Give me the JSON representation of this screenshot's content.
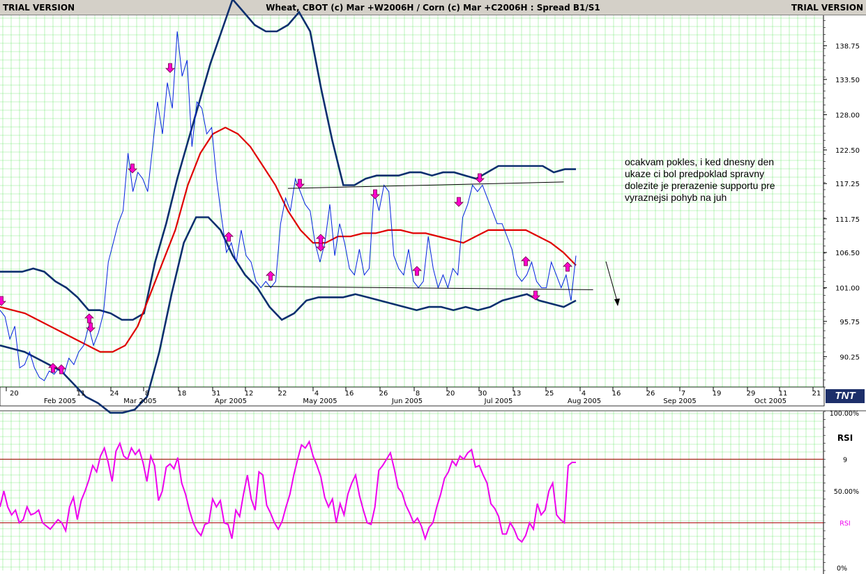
{
  "window": {
    "trial_left": "TRIAL VERSION",
    "trial_right": "TRIAL VERSION",
    "title": "Wheat, CBOT (c) Mar +W2006H / Corn (c) Mar +C2006H : Spread B1/S1"
  },
  "annotation": {
    "lines": [
      "ocakvam pokles, i ked dnesny den",
      "ukaze ci bol predpoklad spravny",
      "dolezite je prerazenie supportu pre",
      "vyraznejsi pohyb na juh"
    ]
  },
  "logo": {
    "text": "TNT"
  },
  "colors": {
    "background": "#ffffff",
    "grid": "#33dd33",
    "price_line": "#0022dd",
    "bands": "#0b2f6e",
    "moving_average": "#e00000",
    "rsi_line": "#ee00ee",
    "arrows": "#ff00cc",
    "rsi_levels": "#aa0000"
  },
  "chart_data": [
    {
      "type": "line",
      "title": "Wheat, CBOT (c) Mar +W2006H / Corn (c) Mar +C2006H : Spread B1/S1",
      "x_axis": {
        "tick_labels": [
          "20",
          "11",
          "24",
          "8",
          "18",
          "31",
          "12",
          "22",
          "4",
          "16",
          "26",
          "8",
          "20",
          "30",
          "13",
          "25",
          "4",
          "16",
          "26",
          "7",
          "19",
          "29",
          "11",
          "21"
        ],
        "month_labels": [
          "Feb 2005",
          "Mar 2005",
          "Apr 2005",
          "May 2005",
          "Jun 2005",
          "Jul 2005",
          "Aug 2005",
          "Sep 2005",
          "Oct 2005"
        ]
      },
      "y_axis": {
        "tick_labels": [
          "138.75",
          "133.50",
          "128.00",
          "122.50",
          "117.25",
          "111.75",
          "106.50",
          "101.00",
          "95.75",
          "90.25"
        ],
        "ylim": [
          85.5,
          143.5
        ],
        "position": "right"
      },
      "grid": true,
      "series": [
        {
          "key": "price",
          "values": [
            97.5,
            96.5,
            93,
            95,
            88.5,
            89,
            91,
            88.5,
            87,
            86.5,
            88,
            87.5,
            88.5,
            87.5,
            90,
            89,
            91,
            92,
            95,
            92,
            94,
            97,
            105,
            108,
            111,
            113,
            122,
            116,
            119,
            118,
            116,
            123,
            130,
            125,
            133,
            129,
            141,
            134,
            136.5,
            123,
            130,
            129,
            125,
            126,
            118,
            112,
            106.5,
            108,
            105,
            110,
            106,
            105,
            102,
            101,
            102,
            101,
            102,
            111,
            115,
            113,
            118,
            116,
            114,
            113,
            108,
            105,
            108,
            114,
            106,
            111,
            108,
            104,
            103,
            107,
            103,
            104,
            116,
            113,
            117,
            116,
            106,
            104,
            103,
            107,
            102,
            101,
            102,
            109,
            104,
            101,
            103,
            101,
            104,
            103,
            112,
            114,
            117,
            116,
            117,
            115,
            113,
            111,
            111,
            109,
            107,
            103,
            102,
            103,
            105,
            102,
            101,
            101,
            105,
            103,
            101,
            103,
            99,
            106
          ],
          "x_start": "Jan 20, 2005",
          "x_end": "Aug 3, 2005"
        },
        {
          "key": "upper_band",
          "values": [
            103.5,
            103.5,
            103.5,
            104,
            103.5,
            102,
            101,
            99.5,
            97.5,
            97.5,
            97,
            96,
            96,
            97,
            105,
            111,
            118,
            124,
            130,
            136,
            141,
            146,
            144,
            142,
            141,
            141,
            142,
            144,
            141,
            132,
            124,
            117,
            117,
            118,
            118.5,
            118.5,
            118.5,
            119,
            119,
            118.5,
            119,
            119,
            118.5,
            118,
            119,
            120,
            120,
            120,
            120,
            120,
            119,
            119.5,
            119.5
          ],
          "x_start": "Jan 20, 2005",
          "x_end": "Aug 3, 2005"
        },
        {
          "key": "moving_average",
          "values": [
            98,
            97.5,
            97,
            96,
            95,
            94,
            93,
            92,
            91,
            91,
            92,
            95,
            100,
            105,
            110,
            117,
            122,
            125,
            126,
            125,
            123,
            120,
            117,
            113,
            110,
            108,
            108,
            109,
            109,
            109.5,
            109.5,
            110,
            110,
            109.5,
            109.5,
            109,
            108.5,
            108,
            109,
            110,
            110,
            110,
            110,
            109,
            108,
            106.5,
            104.5
          ],
          "x_start": "Jan 20, 2005",
          "x_end": "Aug 3, 2005"
        },
        {
          "key": "lower_band",
          "values": [
            92,
            91.5,
            91,
            90,
            89,
            88,
            86,
            84,
            83,
            81.5,
            81.5,
            82,
            84,
            91,
            100,
            108,
            112,
            112,
            110,
            106,
            103,
            101,
            98,
            96,
            97,
            99,
            99.5,
            99.5,
            99.5,
            100,
            99.5,
            99,
            98.5,
            98,
            97.5,
            98,
            98,
            97.5,
            98,
            97.5,
            98,
            99,
            99.5,
            100,
            99,
            98.5,
            98,
            99
          ],
          "x_start": "Jan 20, 2005",
          "x_end": "Aug 3, 2005"
        },
        {
          "key": "resistance_line",
          "points": [
            [
              "Apr 26, 2005",
              116.5
            ],
            [
              "Jul 29, 2005",
              117.5
            ]
          ]
        },
        {
          "key": "support_line",
          "points": [
            [
              "Apr 18, 2005",
              101.2
            ],
            [
              "Aug 8, 2005",
              100.7
            ]
          ]
        }
      ],
      "signals": {
        "sell_down_arrows": [
          "Jan 20",
          "Feb 15",
          "Mar 7",
          "Mar 18",
          "Apr 28",
          "May 31",
          "Jul 20",
          "Jul 30",
          "Aug 5"
        ],
        "buy_up_arrows": [
          "Feb 5",
          "Feb 7",
          "Apr 15",
          "Apr 20",
          "May 6",
          "Jun 5",
          "Jul 22",
          "Aug 2",
          "Aug 8"
        ]
      }
    },
    {
      "type": "line",
      "title": "RSI",
      "y_axis": {
        "tick_labels": [
          "100.00%",
          "9",
          "50.00%",
          "RSI",
          "0%"
        ],
        "ylim": [
          0,
          100
        ]
      },
      "levels": [
        70,
        30
      ],
      "series": [
        {
          "key": "rsi",
          "name": "RSI",
          "values": [
            40,
            50,
            40,
            35,
            38,
            30,
            32,
            40,
            35,
            36,
            38,
            30,
            28,
            26,
            29,
            32,
            30,
            25,
            40,
            46,
            32,
            44,
            50,
            57,
            66,
            62,
            72,
            77,
            68,
            56,
            75,
            80,
            72,
            70,
            77,
            73,
            76,
            68,
            56,
            72,
            66,
            44,
            50,
            65,
            67,
            64,
            71,
            55,
            48,
            38,
            30,
            25,
            22,
            29,
            30,
            45,
            40,
            44,
            30,
            29,
            20,
            38,
            34,
            48,
            60,
            45,
            38,
            62,
            60,
            41,
            36,
            30,
            26,
            31,
            40,
            48,
            60,
            70,
            79,
            77,
            81,
            72,
            66,
            59,
            46,
            40,
            45,
            30,
            42,
            35,
            48,
            55,
            60,
            47,
            38,
            30,
            29,
            40,
            63,
            66,
            70,
            74,
            64,
            52,
            49,
            41,
            36,
            30,
            33,
            28,
            20,
            27,
            30,
            40,
            48,
            58,
            62,
            69,
            66,
            72,
            70,
            74,
            76,
            65,
            66,
            60,
            55,
            42,
            39,
            34,
            23,
            23,
            30,
            26,
            20,
            18,
            22,
            30,
            26,
            42,
            35,
            38,
            50,
            55,
            35,
            32,
            30,
            66,
            68,
            68
          ],
          "x_start": "Jan 20, 2005",
          "x_end": "Aug 3, 2005"
        }
      ]
    }
  ]
}
